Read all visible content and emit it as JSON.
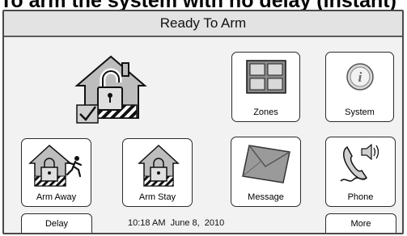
{
  "page_heading": "To arm the system with no delay (instant)",
  "status_title": "Ready To Arm",
  "tiles": {
    "zones": "Zones",
    "system": "System",
    "arm_away": "Arm Away",
    "arm_stay": "Arm Stay",
    "message": "Message",
    "phone": "Phone"
  },
  "buttons": {
    "delay": "Delay",
    "more": "More"
  },
  "datetime": "10:18 AM  June 8,  2010",
  "icons": {
    "status": "house-lock-check-icon",
    "zones": "zones-grid-icon",
    "system": "info-icon",
    "arm_away": "house-lock-running-man-icon",
    "arm_stay": "house-lock-icon",
    "message": "envelope-icon",
    "phone": "phone-icon"
  }
}
